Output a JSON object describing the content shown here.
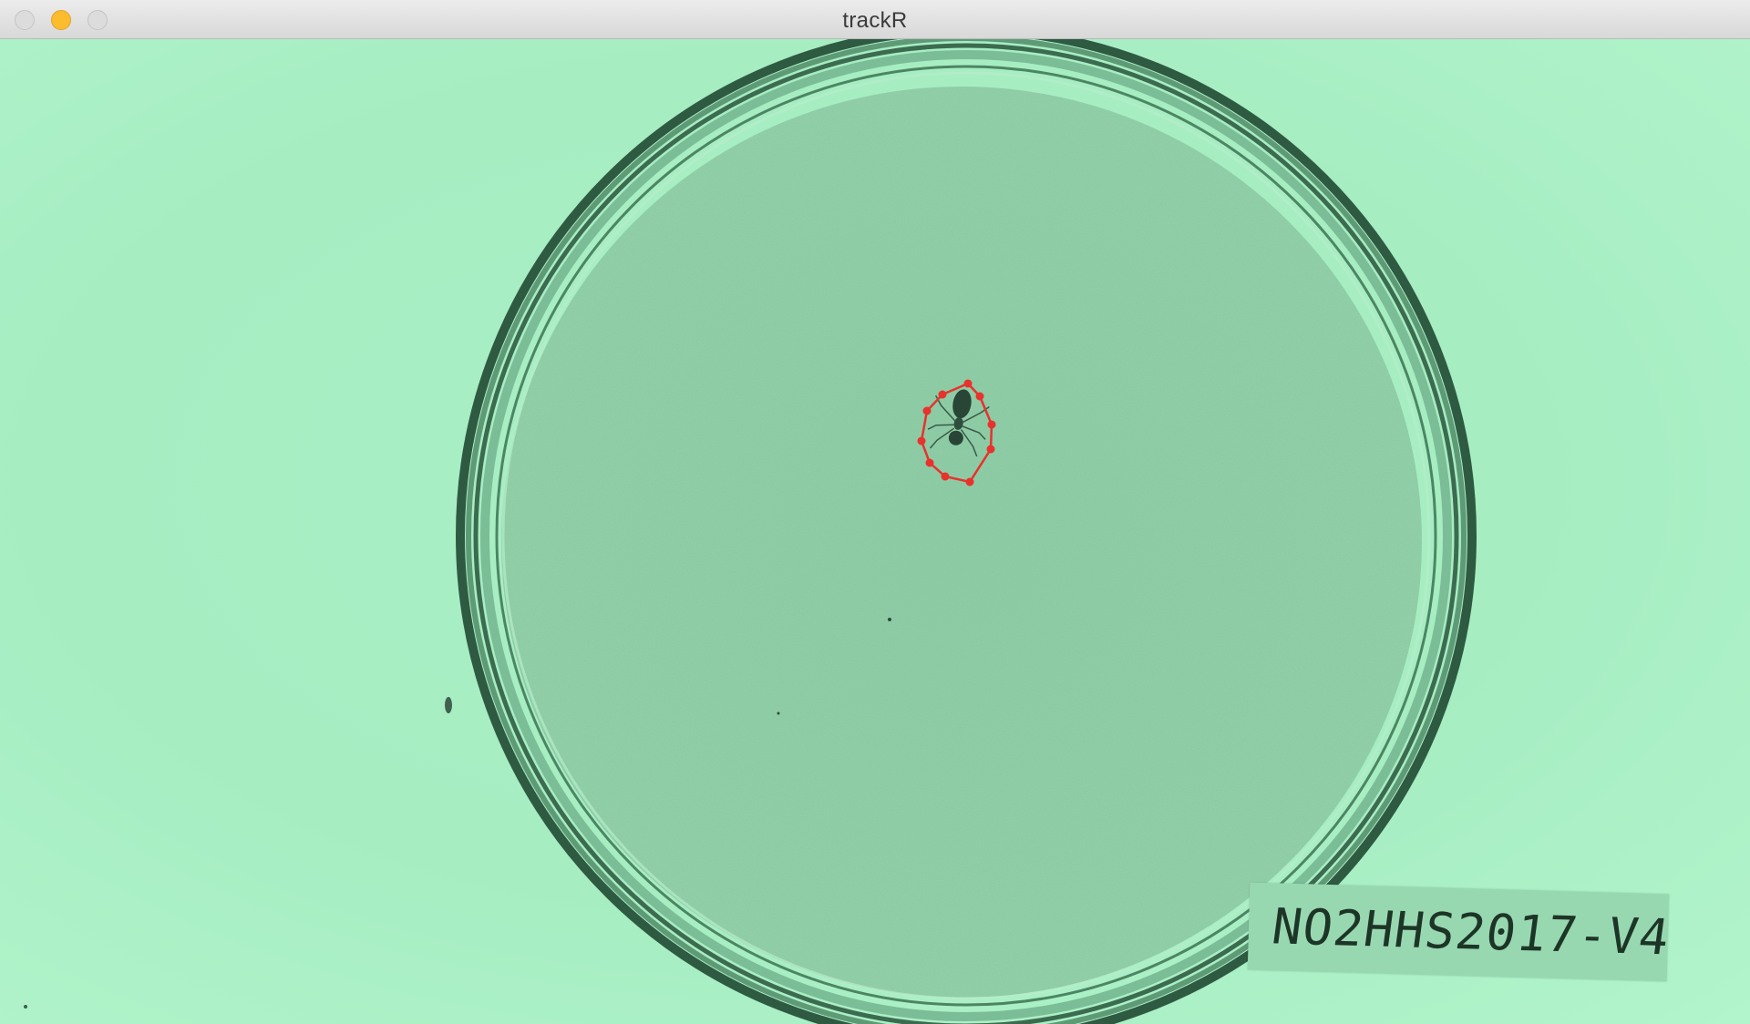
{
  "window": {
    "title": "trackR",
    "buttons": [
      "close",
      "minimize",
      "zoom"
    ]
  },
  "video": {
    "specimen_label": "NO2HHS2017-V4",
    "tracking_overlay_color": "#e8322c",
    "tracked_object": "ant",
    "background_tint": "#a8efc4"
  },
  "icons": {
    "close": "close-icon",
    "minimize": "minimize-icon",
    "zoom": "zoom-icon"
  }
}
